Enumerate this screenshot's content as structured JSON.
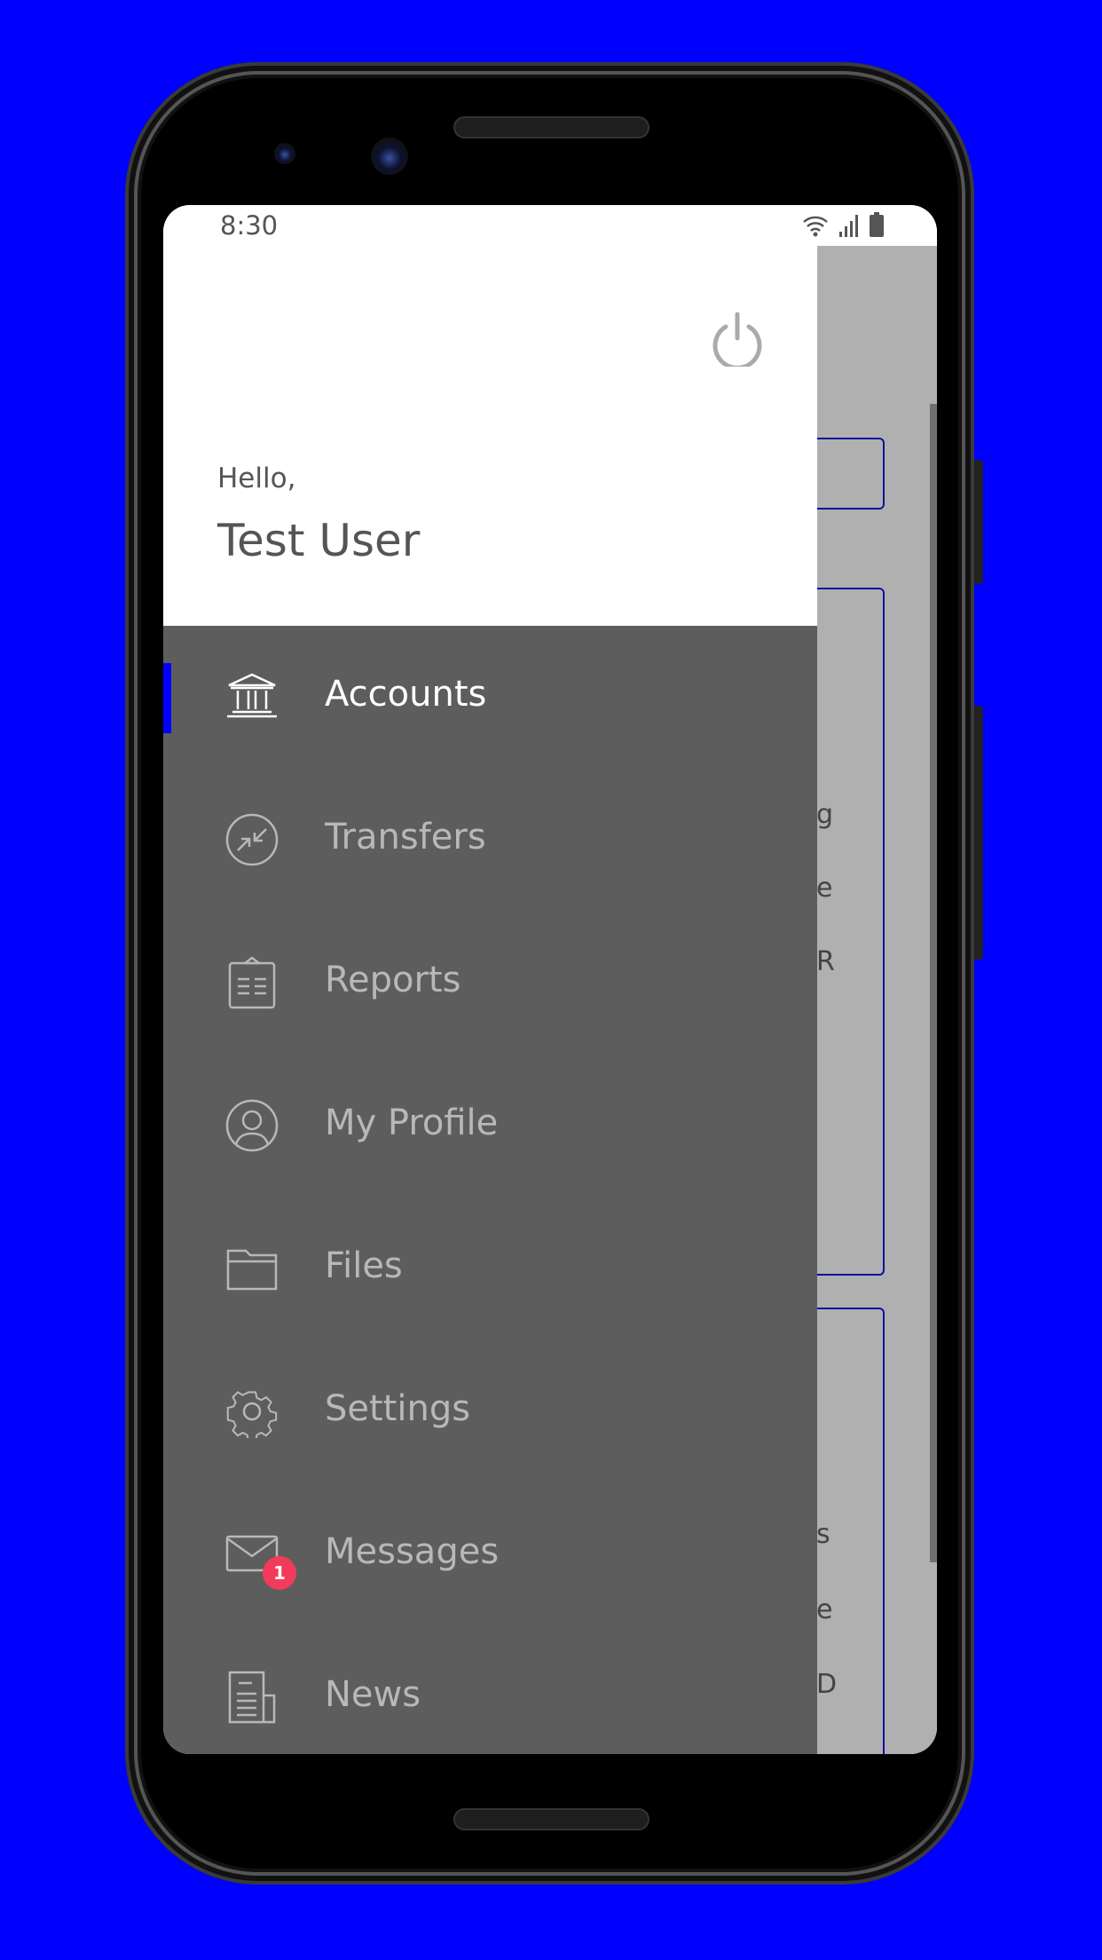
{
  "status_bar": {
    "time": "8:30",
    "icons": [
      "wifi-icon",
      "signal-icon",
      "battery-icon"
    ]
  },
  "drawer": {
    "greeting": "Hello,",
    "user_name": "Test User",
    "logout_icon": "power-icon",
    "items": [
      {
        "label": "Accounts",
        "icon": "bank-icon",
        "active": true
      },
      {
        "label": "Transfers",
        "icon": "transfer-arrows-icon"
      },
      {
        "label": "Reports",
        "icon": "clipboard-icon"
      },
      {
        "label": "My Profile",
        "icon": "user-circle-icon"
      },
      {
        "label": "Files",
        "icon": "folder-icon"
      },
      {
        "label": "Settings",
        "icon": "gear-icon"
      },
      {
        "label": "Messages",
        "icon": "mail-icon",
        "badge": "1"
      },
      {
        "label": "News",
        "icon": "newspaper-icon"
      }
    ]
  },
  "background": {
    "fragments": [
      "g",
      "e",
      "R",
      "s",
      "e",
      "D"
    ]
  },
  "colors": {
    "accent": "#0000ff",
    "badge": "#f23b5a",
    "drawer": "#5d5d5d",
    "overlay": "#b0b0b0",
    "card_border": "#1010a0"
  }
}
